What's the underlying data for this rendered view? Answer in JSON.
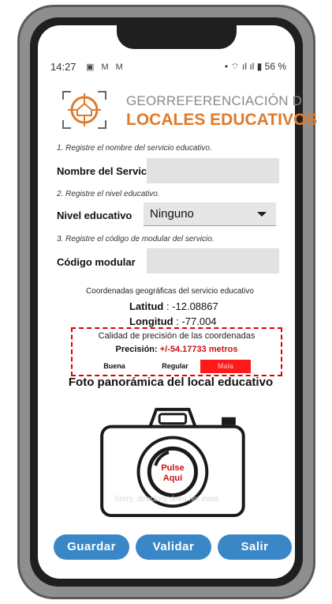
{
  "status_bar": {
    "time": "14:27",
    "notifications": "▣ M M",
    "battery": "56 %"
  },
  "brand": {
    "line1": "GEORREFERENCIACIÓN DE",
    "line2": "LOCALES EDUCATIVOS",
    "accent_color": "#e07a2a"
  },
  "steps": {
    "step1": "1. Registre el nombre del servicio educativo.",
    "step2": "2. Registre el nivel educativo.",
    "step3": "3. Registre el código de modular del servicio."
  },
  "form": {
    "service_name_label": "Nombre del Servicio",
    "service_name_value": "",
    "level_label": "Nivel educativo",
    "level_value": "Ninguno",
    "modular_code_label": "Código modular",
    "modular_code_value": ""
  },
  "coordinates": {
    "title": "Coordenadas geográficas del servicio educativo",
    "lat_label": "Latitud",
    "lat_value": ": -12.08867",
    "lon_label": "Longitud",
    "lon_value": ": -77.004"
  },
  "quality": {
    "title": "Calidad de precisión de las coordenadas",
    "precision_label": "Precisión:",
    "precision_value": "+/-54.17733 metros",
    "good": "Buena",
    "regular": "Regular",
    "bad": "Mala",
    "selected": "Mala",
    "highlight_color": "#ff1a1a"
  },
  "photo": {
    "title": "Foto panorámica del local educativo",
    "pulse_line1": "Pulse",
    "pulse_line2": "Aquí",
    "error_text": "Sorry, directory does not exist."
  },
  "buttons": {
    "save": "Guardar",
    "validate": "Validar",
    "exit": "Salir",
    "color": "#3a87c8"
  }
}
